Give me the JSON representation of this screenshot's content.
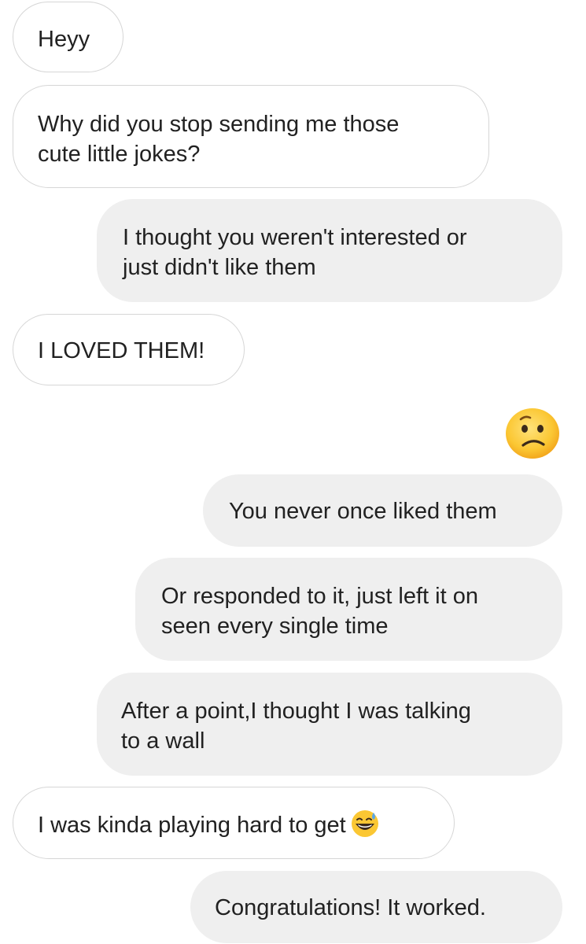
{
  "messages": [
    {
      "side": "received",
      "lines": [
        "Heyy"
      ]
    },
    {
      "side": "received",
      "lines": [
        "Why did you stop sending me those",
        "cute little jokes?"
      ]
    },
    {
      "side": "sent",
      "lines": [
        "I thought you weren't interested or",
        "just didn't like them"
      ]
    },
    {
      "side": "received",
      "lines": [
        "I LOVED THEM!"
      ]
    },
    {
      "side": "sent",
      "emoji": "confused-face-icon"
    },
    {
      "side": "sent",
      "lines": [
        "You never once liked them"
      ]
    },
    {
      "side": "sent",
      "lines": [
        "Or responded to it, just left it on",
        "seen every single time"
      ]
    },
    {
      "side": "sent",
      "lines": [
        "After a point,I thought I was talking",
        "to a wall"
      ]
    },
    {
      "side": "received",
      "lines": [
        "I was kinda playing hard to get"
      ],
      "trailing_emoji": "grinning-sweat-face-icon"
    },
    {
      "side": "sent",
      "lines": [
        "Congratulations! It worked."
      ]
    }
  ],
  "colors": {
    "received_bg": "#ffffff",
    "received_border": "#d6d6d6",
    "sent_bg": "#efefef",
    "text": "#212121",
    "emoji_yellow": "#fbc02d"
  }
}
